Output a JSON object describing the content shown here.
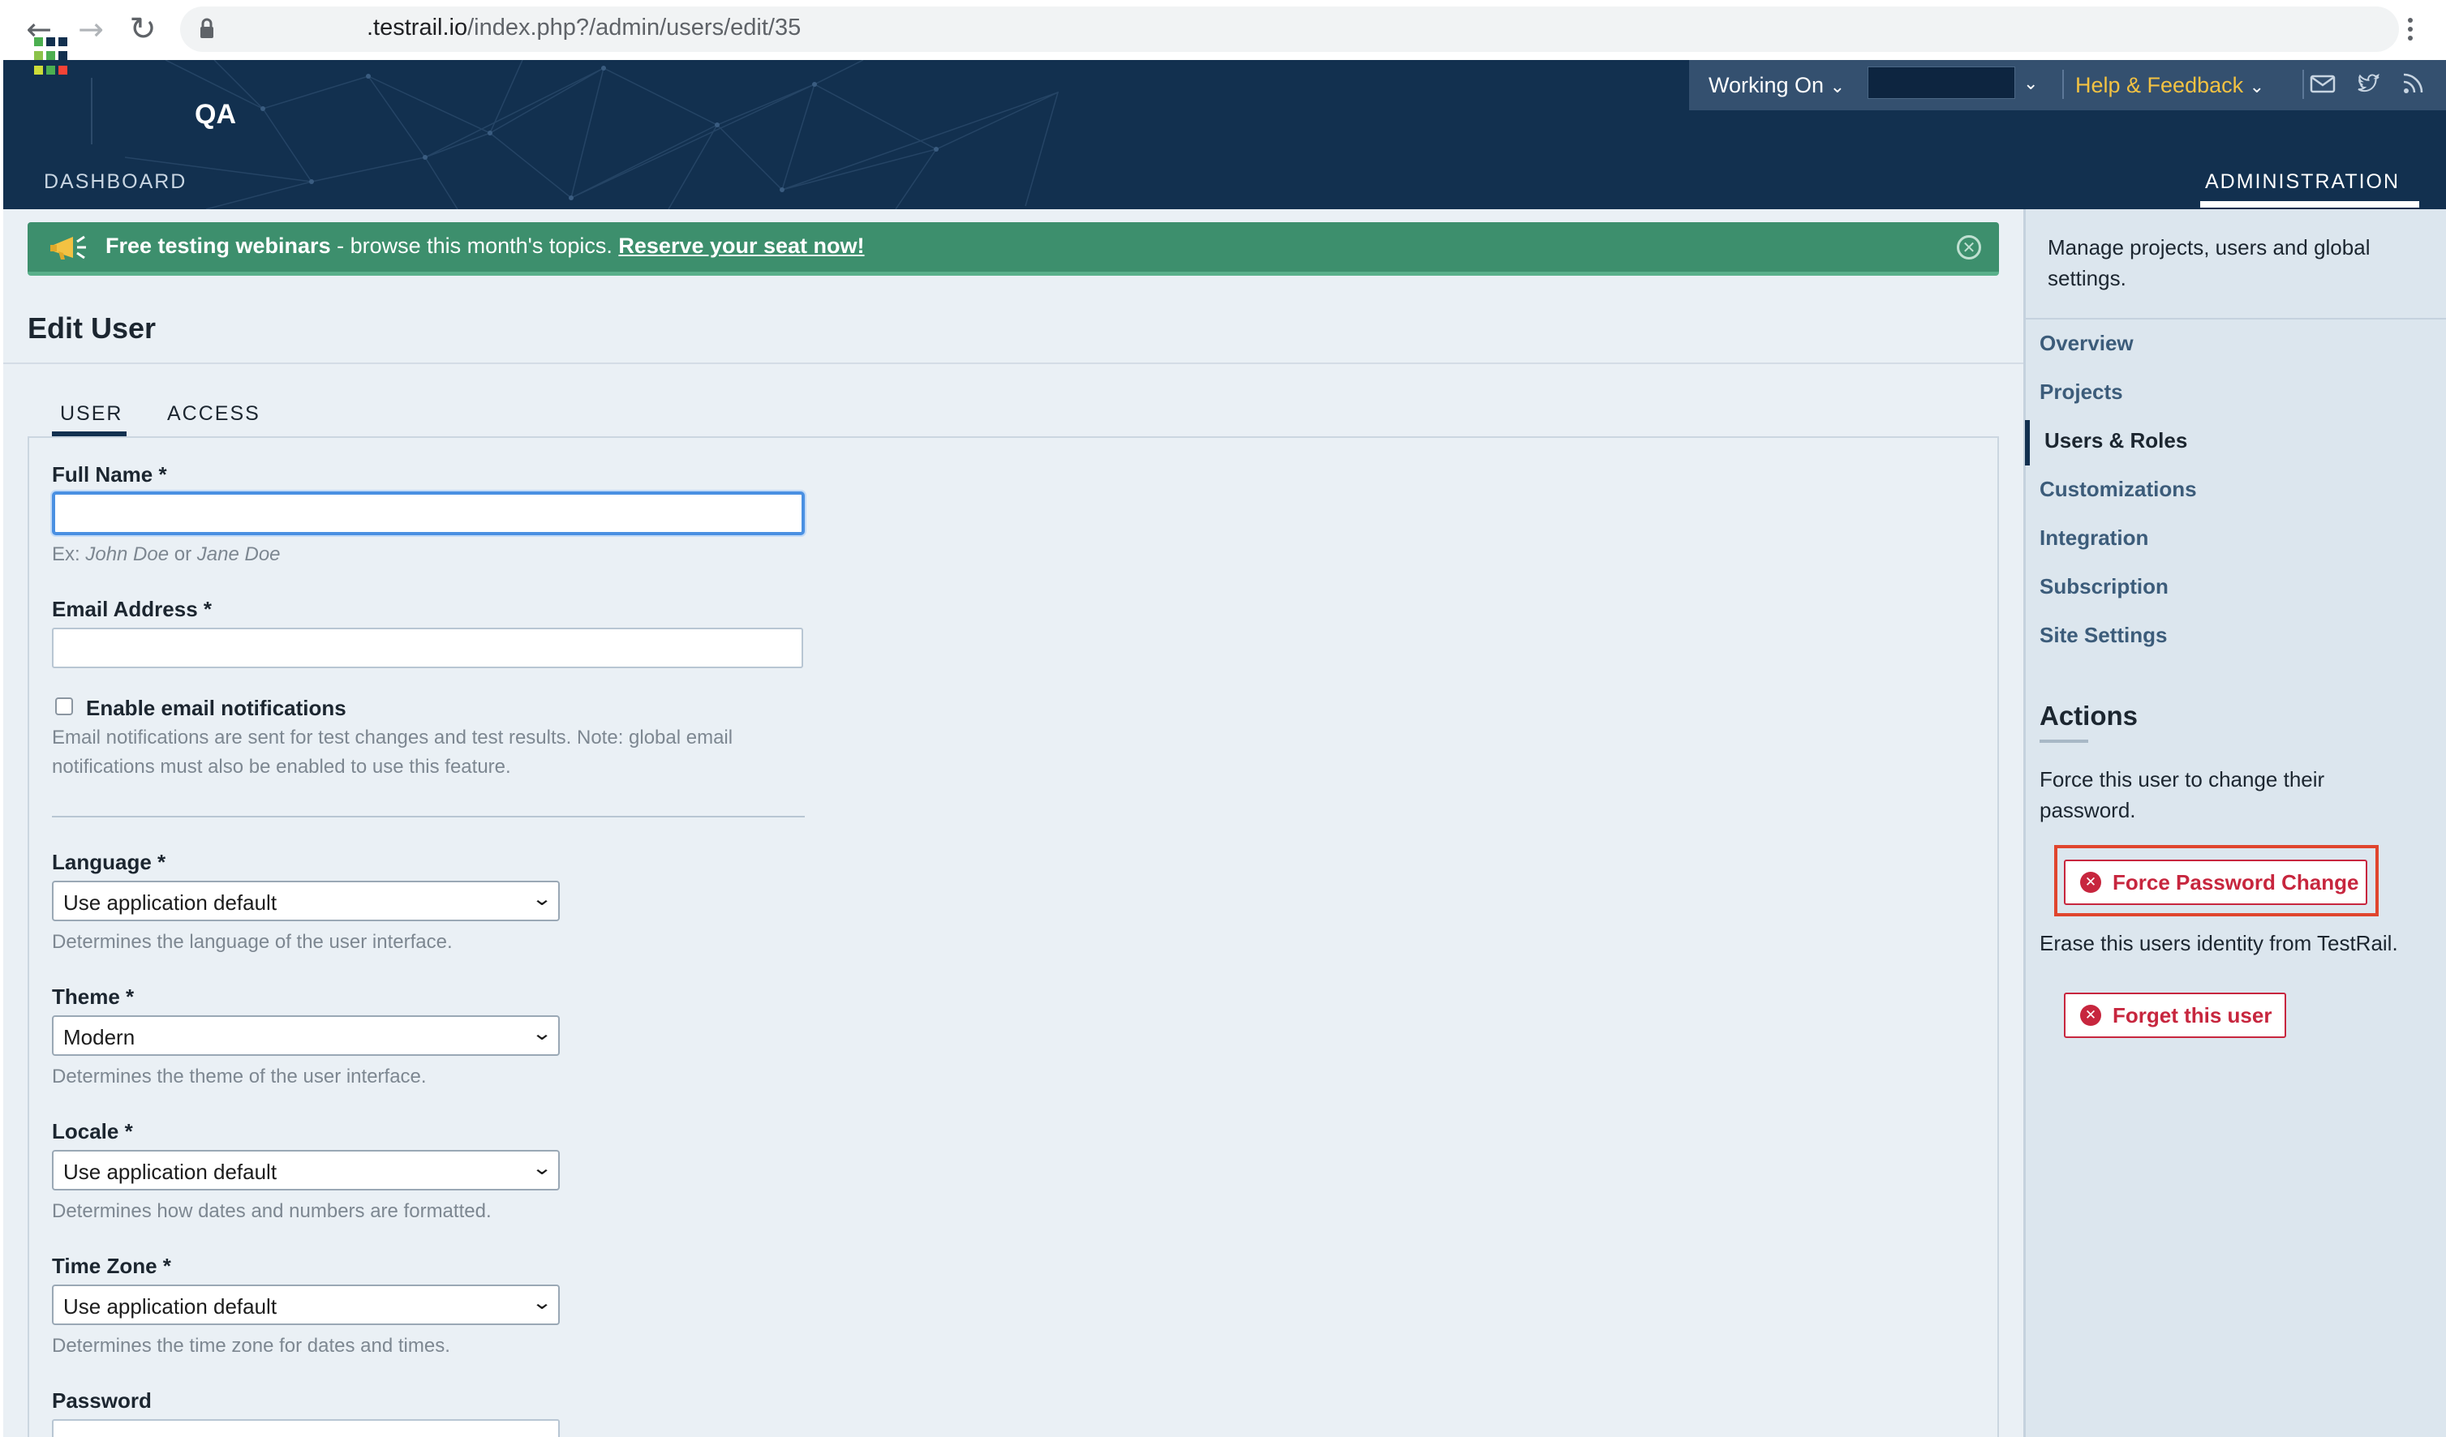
{
  "browser": {
    "url_host": ".testrail.io",
    "url_path": "/index.php?/admin/users/edit/35"
  },
  "header": {
    "project_name": "QA",
    "dashboard_label": "DASHBOARD",
    "administration_label": "ADMINISTRATION",
    "working_on_label": "Working On",
    "help_feedback_label": "Help & Feedback",
    "logo_colors": [
      "#4caf50",
      "#2e7d32",
      "#12304f",
      "#8bc34a",
      "#4caf50",
      "#12304f",
      "#cddc39",
      "#f44336",
      "#12304f"
    ]
  },
  "banner": {
    "bold_text": "Free testing webinars",
    "text": " - browse this month's topics. ",
    "link_text": "Reserve your seat now!"
  },
  "page": {
    "title": "Edit User"
  },
  "tabs": [
    {
      "label": "USER",
      "active": true
    },
    {
      "label": "ACCESS",
      "active": false
    }
  ],
  "form": {
    "full_name": {
      "label": "Full Name",
      "required": "*",
      "value": "",
      "hint_prefix": "Ex: ",
      "hint_example1": "John Doe",
      "hint_or": " or ",
      "hint_example2": "Jane Doe"
    },
    "email": {
      "label": "Email Address",
      "required": "*",
      "value": ""
    },
    "notifications": {
      "label": "Enable email notifications",
      "checked": false,
      "description": "Email notifications are sent for test changes and test results. Note: global email notifications must also be enabled to use this feature."
    },
    "language": {
      "label": "Language",
      "required": "*",
      "value": "Use application default",
      "hint": "Determines the language of the user interface."
    },
    "theme": {
      "label": "Theme",
      "required": "*",
      "value": "Modern",
      "hint": "Determines the theme of the user interface."
    },
    "locale": {
      "label": "Locale",
      "required": "*",
      "value": "Use application default",
      "hint": "Determines how dates and numbers are formatted."
    },
    "timezone": {
      "label": "Time Zone",
      "required": "*",
      "value": "Use application default",
      "hint": "Determines the time zone for dates and times."
    },
    "password": {
      "label": "Password"
    }
  },
  "sidebar": {
    "intro": "Manage projects, users and global settings.",
    "links": [
      {
        "label": "Overview",
        "active": false
      },
      {
        "label": "Projects",
        "active": false
      },
      {
        "label": "Users & Roles",
        "active": true
      },
      {
        "label": "Customizations",
        "active": false
      },
      {
        "label": "Integration",
        "active": false
      },
      {
        "label": "Subscription",
        "active": false
      },
      {
        "label": "Site Settings",
        "active": false
      }
    ],
    "actions_heading": "Actions",
    "force_description": "Force this user to change their password.",
    "force_button": "Force Password Change",
    "erase_description": "Erase this users identity from TestRail.",
    "forget_button": "Forget this user"
  },
  "colors": {
    "header_bg": "#12304f",
    "banner_bg": "#3d8f6d",
    "danger": "#c7263e",
    "highlight": "#e0452e",
    "link": "#3c5c7a",
    "help_accent": "#f3c242"
  }
}
